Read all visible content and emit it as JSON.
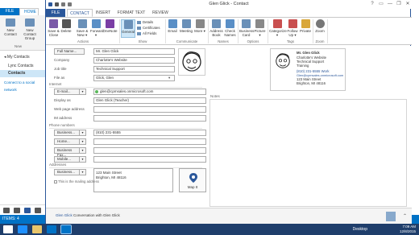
{
  "background_app": {
    "tabs": {
      "file": "FILE",
      "home": "HOME"
    },
    "ribbon": {
      "new_contact": "New Contact",
      "new_contact_group": "New Contact Group",
      "new_group_label": "New"
    },
    "nav": {
      "my_contacts": "◂ My Contacts",
      "lync_contacts": "Lync Contacts",
      "contacts": "Contacts",
      "social_link": "Connect to a social network"
    },
    "status": "ITEMS: 4"
  },
  "window": {
    "title": "Glen Glick - Contact",
    "help": "?",
    "controls": {
      "minimize": "—",
      "restore": "❐",
      "close": "✕"
    }
  },
  "tabs": [
    {
      "label": "FILE"
    },
    {
      "label": "CONTACT"
    },
    {
      "label": "INSERT"
    },
    {
      "label": "FORMAT TEXT"
    },
    {
      "label": "REVIEW"
    }
  ],
  "ribbon": {
    "save_close": "Save & Close",
    "delete": "Delete",
    "save_new": "Save & New ▾",
    "forward": "Forward ▾",
    "onenote": "OneNote",
    "general": "General",
    "details": "Details",
    "certificates": "Certificates",
    "all_fields": "All Fields",
    "email": "Email",
    "meeting": "Meeting",
    "more": "More ▾",
    "address_book": "Address Book",
    "check_names": "Check Names",
    "business_card": "Business Card",
    "picture": "Picture ▾",
    "categorize": "Categorize ▾",
    "follow_up": "Follow Up ▾",
    "private": "Private",
    "zoom": "Zoom",
    "groups": {
      "actions": "Actions",
      "show": "Show",
      "communicate": "Communicate",
      "names": "Names",
      "options": "Options",
      "tags": "Tags",
      "zoom": "Zoom"
    }
  },
  "form": {
    "full_name_btn": "Full Name...",
    "full_name": "Mr. Glen Glick",
    "company_label": "Company",
    "company": "Charlotte's Website",
    "job_title_label": "Job title",
    "job_title": "Technical Support",
    "file_as_label": "File as",
    "file_as": "Glick, Glen",
    "internet_section": "Internet",
    "email_btn": "E-mail...",
    "email": "glen@cpmsales.onmicrosoft.com",
    "display_as_label": "Display as",
    "display_as": "Glen Glick (Teacher)",
    "web_label": "Web page address",
    "im_label": "IM address",
    "phone_section": "Phone numbers",
    "phones": [
      {
        "btn": "Business...",
        "value": "(810) 231-5555"
      },
      {
        "btn": "Home...",
        "value": ""
      },
      {
        "btn": "Business Fax...",
        "value": ""
      },
      {
        "btn": "Mobile...",
        "value": ""
      }
    ],
    "addresses_section": "Addresses",
    "address_btn": "Business...",
    "address": "123 Main Street\nBrighton, MI 48116",
    "mailing_check": "This is the mailing address",
    "map_it": "Map It",
    "notes_label": "Notes"
  },
  "business_card": {
    "name": "Mr. Glen Glick",
    "company": "Charlotte's Website",
    "title": "Technical Support",
    "dept": "Training",
    "phone": "(810) 231-5555 Work",
    "email": "Glen@cpmsales.onmicrosoft.com",
    "street": "123 Main Street",
    "city": "Brighton, MI 48116"
  },
  "people_pane": {
    "name": "Glen Glick",
    "text": " Conversation with Glen Glick"
  },
  "taskbar": {
    "desktop": "Desktop",
    "time": "7:09 AM",
    "date": "12/8/2015"
  },
  "colors": {
    "accent": "#2b579a",
    "outlook_blue": "#0072c6",
    "taskbar": "#1f3e6b"
  }
}
